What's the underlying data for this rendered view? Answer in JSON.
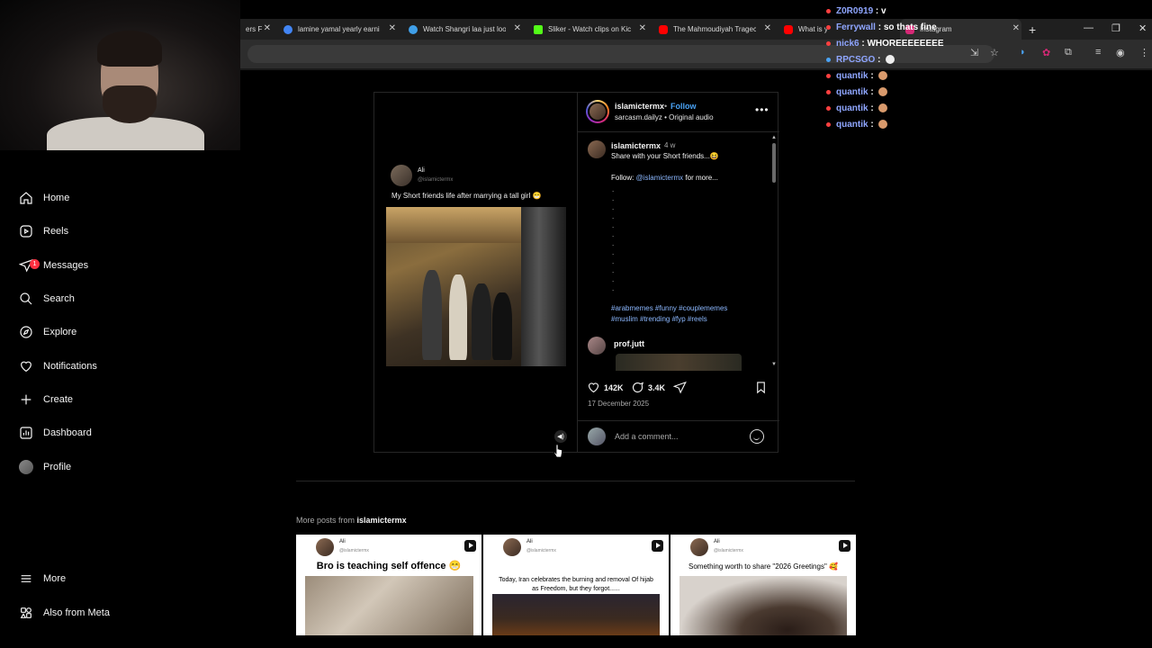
{
  "browser": {
    "tabs": [
      {
        "title": "ers F",
        "icon_color": "#888888"
      },
      {
        "title": "lamine yamal yearly earni",
        "icon_color": "#4285f4"
      },
      {
        "title": "Watch Shangri laa just loo",
        "icon_color": "#3f9fe8"
      },
      {
        "title": "Sliker - Watch clips on Kic",
        "icon_color": "#53fc18"
      },
      {
        "title": "The Mahmoudiyah Tragec",
        "icon_color": "#ff0000"
      },
      {
        "title": "What is y",
        "icon_color": "#ff0000"
      },
      {
        "title": "Instagram",
        "icon_color": "#d62976"
      }
    ]
  },
  "chat": [
    {
      "user": "Z0R0919",
      "msg": "v",
      "dot": "#ff4040",
      "emoji": false
    },
    {
      "user": "Ferrywall",
      "msg": "so thats fine",
      "dot": "#ff4040",
      "emoji": false
    },
    {
      "user": "nick6",
      "msg": "WHOREEEEEEEE",
      "dot": "#ff4040",
      "emoji": false
    },
    {
      "user": "RPCSGO",
      "msg": "",
      "dot": "#4aa3f5",
      "emoji": true
    },
    {
      "user": "quantik",
      "msg": "",
      "dot": "#ff4040",
      "emoji": true
    },
    {
      "user": "quantik",
      "msg": "",
      "dot": "#ff4040",
      "emoji": true
    },
    {
      "user": "quantik",
      "msg": "",
      "dot": "#ff4040",
      "emoji": true
    },
    {
      "user": "quantik",
      "msg": "",
      "dot": "#ff4040",
      "emoji": true
    }
  ],
  "sidebar": {
    "items": [
      {
        "label": "Home",
        "icon": "home-icon"
      },
      {
        "label": "Reels",
        "icon": "reels-icon"
      },
      {
        "label": "Messages",
        "icon": "messages-icon",
        "badge": "1"
      },
      {
        "label": "Search",
        "icon": "search-icon"
      },
      {
        "label": "Explore",
        "icon": "explore-icon"
      },
      {
        "label": "Notifications",
        "icon": "heart-icon"
      },
      {
        "label": "Create",
        "icon": "plus-icon"
      },
      {
        "label": "Dashboard",
        "icon": "dashboard-icon"
      },
      {
        "label": "Profile",
        "icon": "avatar"
      }
    ],
    "more": "More",
    "meta": "Also from Meta"
  },
  "post": {
    "media": {
      "name": "Ali",
      "handle": "@islamictermx",
      "text": "My Short friends life after marrying a tall girl 😁"
    },
    "header": {
      "username": "islamictermx",
      "separator": "•",
      "follow": "Follow",
      "audio": "sarcasm.dailyz • Original audio"
    },
    "caption": {
      "username": "islamictermx",
      "time": "4 w",
      "text": "Share with your Short friends...😆",
      "follow_prefix": "Follow:",
      "follow_mention": "@islamictermx",
      "follow_suffix": "for more...",
      "dots": ".\n.\n.\n.\n.\n.\n.\n.\n.\n.\n.\n.",
      "hashtags": "#arabmemes #funny #couplememes #muslim #trending #fyp #reels"
    },
    "comment2": {
      "username": "prof.jutt"
    },
    "likes": "142K",
    "comments": "3.4K",
    "date": "17 December 2025",
    "add_comment_placeholder": "Add a comment..."
  },
  "more_posts": {
    "label_prefix": "More posts from",
    "label_user": "islamictermx",
    "items": [
      {
        "name": "Ali",
        "handle": "@islamictermx",
        "caption": "Bro is teaching self offence 😁"
      },
      {
        "name": "Ali",
        "handle": "@islamictermx",
        "caption": "Today, Iran celebrates the burning and removal Of hijab as Freedom, but they forgot......"
      },
      {
        "name": "Ali",
        "handle": "@islamictermx",
        "caption": "Something worth to share \"2026 Greetings\" 🥰"
      }
    ]
  }
}
